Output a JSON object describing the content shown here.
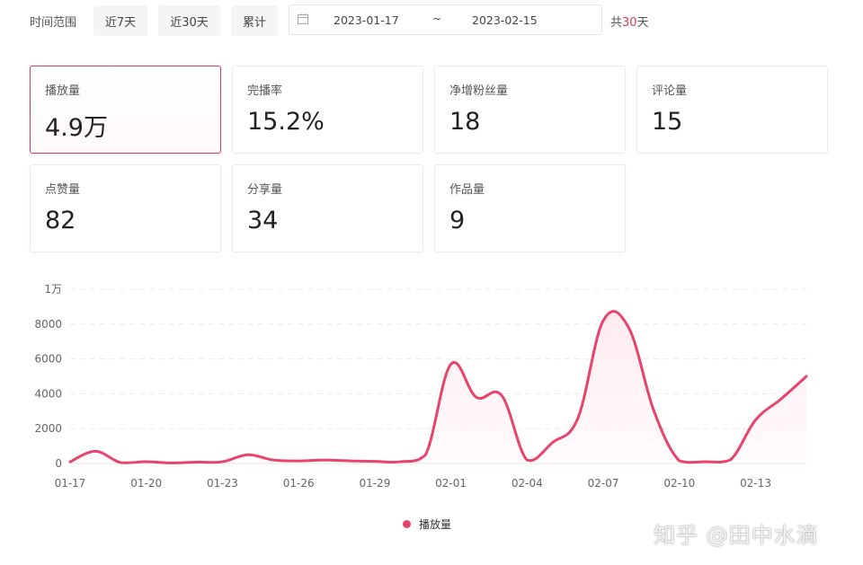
{
  "filter": {
    "label": "时间范围",
    "buttons": [
      "近7天",
      "近30天",
      "累计"
    ],
    "start_date": "2023-01-17",
    "separator": "~",
    "end_date": "2023-02-15",
    "total_prefix": "共",
    "total_days": "30",
    "total_suffix": "天"
  },
  "cards": [
    {
      "label": "播放量",
      "value": "4.9万",
      "active": true
    },
    {
      "label": "完播率",
      "value": "15.2%"
    },
    {
      "label": "净增粉丝量",
      "value": "18"
    },
    {
      "label": "评论量",
      "value": "15"
    },
    {
      "label": "点赞量",
      "value": "82"
    },
    {
      "label": "分享量",
      "value": "34"
    },
    {
      "label": "作品量",
      "value": "9"
    }
  ],
  "icons": {
    "calendar": "calendar-icon"
  },
  "colors": {
    "accent": "#e8385f",
    "line": "#e8436b"
  },
  "watermark": "知乎 @田中水滴",
  "chart_data": {
    "type": "area",
    "x": [
      "01-17",
      "01-18",
      "01-19",
      "01-20",
      "01-21",
      "01-22",
      "01-23",
      "01-24",
      "01-25",
      "01-26",
      "01-27",
      "01-28",
      "01-29",
      "01-30",
      "01-31",
      "02-01",
      "02-02",
      "02-03",
      "02-04",
      "02-05",
      "02-06",
      "02-07",
      "02-08",
      "02-09",
      "02-10",
      "02-11",
      "02-12",
      "02-13",
      "02-14",
      "02-15"
    ],
    "x_tick_labels": [
      "01-17",
      "01-20",
      "01-23",
      "01-26",
      "01-29",
      "02-01",
      "02-04",
      "02-07",
      "02-10",
      "02-13"
    ],
    "series": [
      {
        "name": "播放量",
        "values": [
          100,
          700,
          50,
          100,
          30,
          80,
          100,
          500,
          200,
          150,
          200,
          150,
          120,
          100,
          500,
          5700,
          3800,
          3900,
          200,
          1200,
          2600,
          8200,
          7800,
          3000,
          150,
          100,
          200,
          2500,
          3700,
          5000
        ]
      }
    ],
    "y_ticks": [
      "0",
      "2000",
      "4000",
      "6000",
      "8000",
      "1万"
    ],
    "ylim": [
      0,
      10000
    ],
    "grid": true,
    "legend": "bottom"
  }
}
